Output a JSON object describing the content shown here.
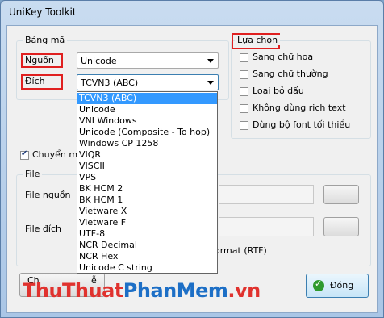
{
  "window": {
    "title": "UniKey Toolkit"
  },
  "bang_ma": {
    "group_label": "Bảng mã",
    "source_label": "Nguồn",
    "source_value": "Unicode",
    "dest_label": "Đích",
    "dest_value": "TCVN3 (ABC)"
  },
  "dropdown": {
    "items": [
      "TCVN3 (ABC)",
      "Unicode",
      "VNI Windows",
      "Unicode (Composite - To hop)",
      "Windows CP 1258",
      "VIQR",
      "VISCII",
      "VPS",
      "BK HCM 2",
      "BK HCM 1",
      "Vietware X",
      "Vietware F",
      "UTF-8",
      "NCR Decimal",
      "NCR Hex",
      "Unicode C string"
    ],
    "selected_index": 0
  },
  "options": {
    "group_label": "Lựa chọn",
    "items": [
      {
        "label": "Sang chữ hoa",
        "checked": false
      },
      {
        "label": "Sang chữ thường",
        "checked": false
      },
      {
        "label": "Loại bỏ dấu",
        "checked": false
      },
      {
        "label": "Không dùng rich text",
        "checked": false
      },
      {
        "label": "Dùng bộ font tối thiểu",
        "checked": false
      }
    ]
  },
  "clipboard": {
    "label": "Chuyển mã",
    "checked": true
  },
  "file": {
    "group_label": "File",
    "source_label": "File nguồn",
    "dest_label": "File đích",
    "rtf_label": "ormat (RTF)"
  },
  "bottom": {
    "left_button_partial": "Ch",
    "left_button_partial2": "ễ",
    "close_label": "Đóng"
  },
  "watermark": {
    "part1": "ThuThuat",
    "part2": "PhanMem",
    "part3": ".vn"
  },
  "colors": {
    "highlight": "#3399ff",
    "annotation": "#e02020"
  }
}
